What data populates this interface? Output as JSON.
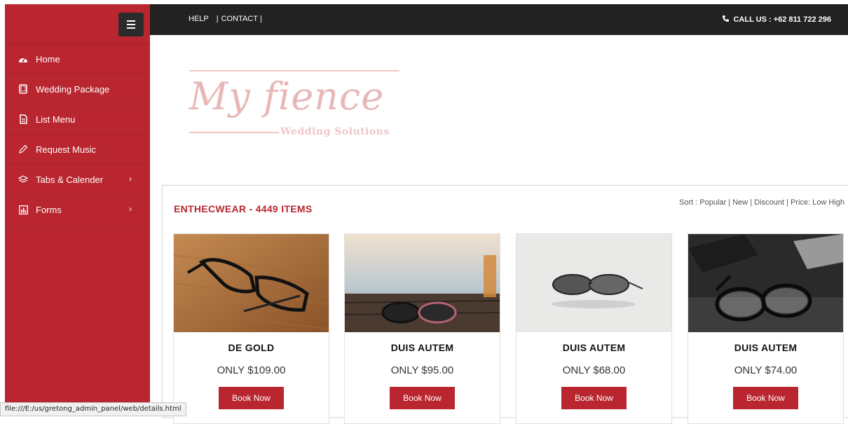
{
  "sidebar": {
    "items": [
      {
        "label": "Home",
        "icon": "dashboard-icon",
        "has_submenu": false
      },
      {
        "label": "Wedding Package",
        "icon": "tablet-icon",
        "has_submenu": false
      },
      {
        "label": "List Menu",
        "icon": "file-text-icon",
        "has_submenu": false
      },
      {
        "label": "Request Music",
        "icon": "pencil-icon",
        "has_submenu": false
      },
      {
        "label": "Tabs & Calender",
        "icon": "layers-icon",
        "has_submenu": true
      },
      {
        "label": "Forms",
        "icon": "bar-chart-icon",
        "has_submenu": true
      }
    ]
  },
  "topbar": {
    "help": "HELP",
    "contact": "CONTACT",
    "separator": "|",
    "call": "CALL US : +62 811 722 296"
  },
  "logo": {
    "script": "My fience",
    "subtitle": "Wedding Solutions"
  },
  "catalog": {
    "title": "ENTHECWEAR - 4449 ITEMS",
    "sort": "Sort : Popular | New | Discount | Price: Low High",
    "products": [
      {
        "name": "DE GOLD",
        "price": "ONLY $109.00",
        "button": "Book Now"
      },
      {
        "name": "DUIS AUTEM",
        "price": "ONLY $95.00",
        "button": "Book Now"
      },
      {
        "name": "DUIS AUTEM",
        "price": "ONLY $68.00",
        "button": "Book Now"
      },
      {
        "name": "DUIS AUTEM",
        "price": "ONLY $74.00",
        "button": "Book Now"
      }
    ]
  },
  "statusbar": {
    "url": "file:///E:/us/gretong_admin_panel/web/details.html"
  },
  "colors": {
    "accent": "#b9262f",
    "topbar": "#222222",
    "logo_pink": "#e8b7b7"
  }
}
